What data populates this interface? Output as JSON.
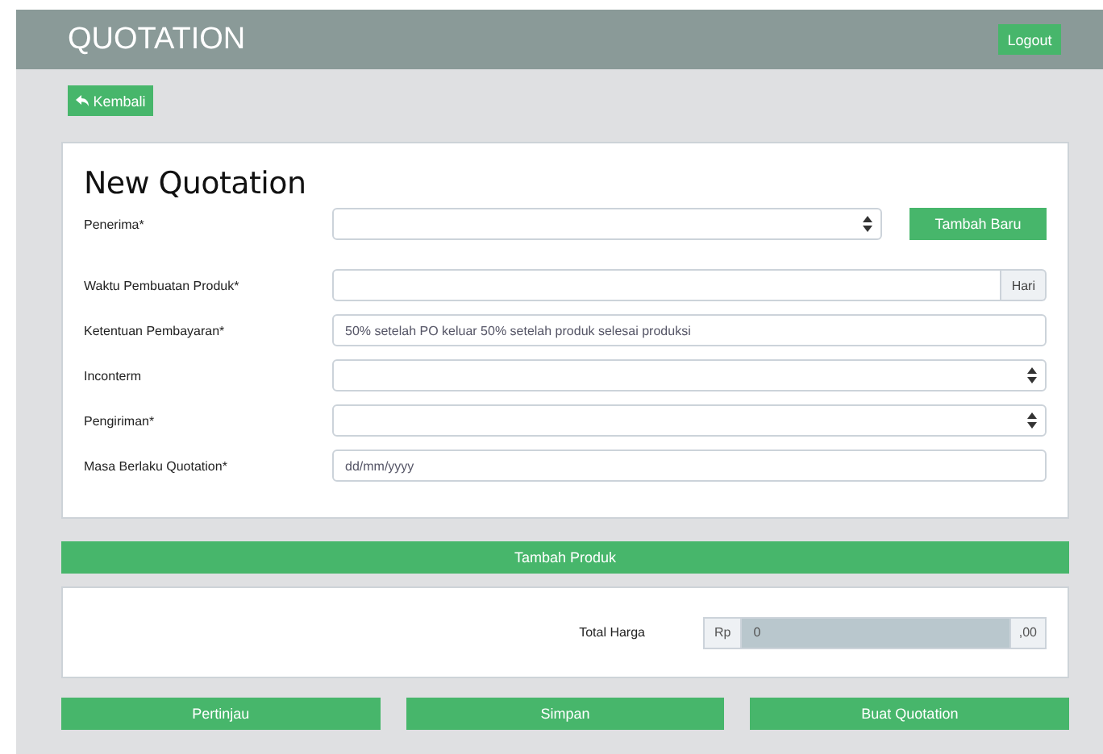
{
  "header": {
    "title": "QUOTATION",
    "logout": "Logout"
  },
  "back_button": {
    "label": "Kembali"
  },
  "form": {
    "title": "New Quotation",
    "fields": [
      {
        "label": "Penerima*",
        "kind": "select",
        "button": "Tambah Baru"
      },
      {
        "label": "Waktu Pembuatan Produk*",
        "kind": "suffix",
        "suffix": "Hari"
      },
      {
        "label": "Ketentuan Pembayaran*",
        "kind": "text",
        "value": "50% setelah PO keluar 50% setelah produk selesai produksi"
      },
      {
        "label": "Inconterm",
        "kind": "select"
      },
      {
        "label": "Pengiriman*",
        "kind": "select"
      },
      {
        "label": "Masa Berlaku Quotation*",
        "kind": "date",
        "placeholder": "dd/mm/yyyy"
      }
    ]
  },
  "add_product_button": "Tambah Produk",
  "total": {
    "label": "Total Harga",
    "prefix": "Rp",
    "value": "0",
    "suffix": ",00"
  },
  "actions": [
    "Pertinjau",
    "Simpan",
    "Buat Quotation"
  ]
}
